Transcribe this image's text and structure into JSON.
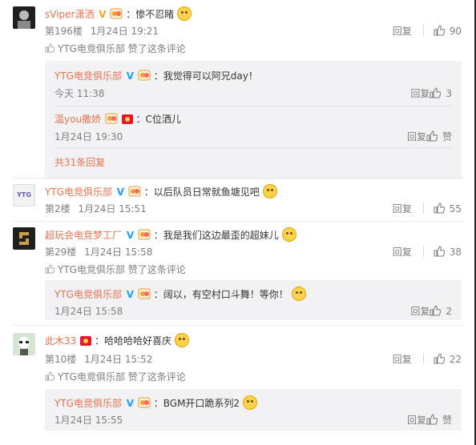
{
  "comments": [
    {
      "user": "sViper潇洒",
      "text": "：惨不忍睹",
      "floor": "第196楼",
      "time": "1月24日 19:21",
      "reply_label": "回复",
      "likes": "90",
      "liked_by": "YTG电竞俱乐部 赞了这条评论",
      "subs": [
        {
          "user": "YTG电竞俱乐部",
          "text": "：我觉得可以阿兄day！",
          "time": "今天 11:38",
          "reply_label": "回复",
          "likes": "3"
        },
        {
          "user": "温you撒娇",
          "text": "：C位洒儿",
          "time": "1月24日 19:30",
          "reply_label": "回复",
          "likes": "赞"
        }
      ],
      "more": "共31条回复"
    },
    {
      "user": "YTG电竞俱乐部",
      "text": "：以后队员日常就鱼塘见吧",
      "floor": "第2楼",
      "time": "1月24日 15:51",
      "reply_label": "回复",
      "likes": "55"
    },
    {
      "user": "超玩会电竞梦工厂",
      "text": "：我是我们这边最歪的超妹儿",
      "floor": "第29楼",
      "time": "1月24日 15:58",
      "reply_label": "回复",
      "likes": "38",
      "liked_by": "YTG电竞俱乐部 赞了这条评论",
      "subs": [
        {
          "user": "YTG电竞俱乐部",
          "text": "：阔以，有空村口斗舞！等你！",
          "time": "1月24日 15:58",
          "reply_label": "回复",
          "likes": "2"
        }
      ]
    },
    {
      "user": "此木33",
      "text": "：哈哈哈哈好喜庆",
      "floor": "第10楼",
      "time": "1月24日 15:52",
      "reply_label": "回复",
      "likes": "22",
      "liked_by": "YTG电竞俱乐部 赞了这条评论",
      "subs": [
        {
          "user": "YTG电竞俱乐部",
          "text": "：BGM开口跪系列2",
          "time": "1月24日 15:55",
          "reply_label": "回复",
          "likes": "赞"
        }
      ]
    }
  ],
  "avatar_ytg_text": "YTG",
  "colors": {
    "username": "#eb7350",
    "meta": "#808080",
    "sub_bg": "#f2f2f5"
  }
}
